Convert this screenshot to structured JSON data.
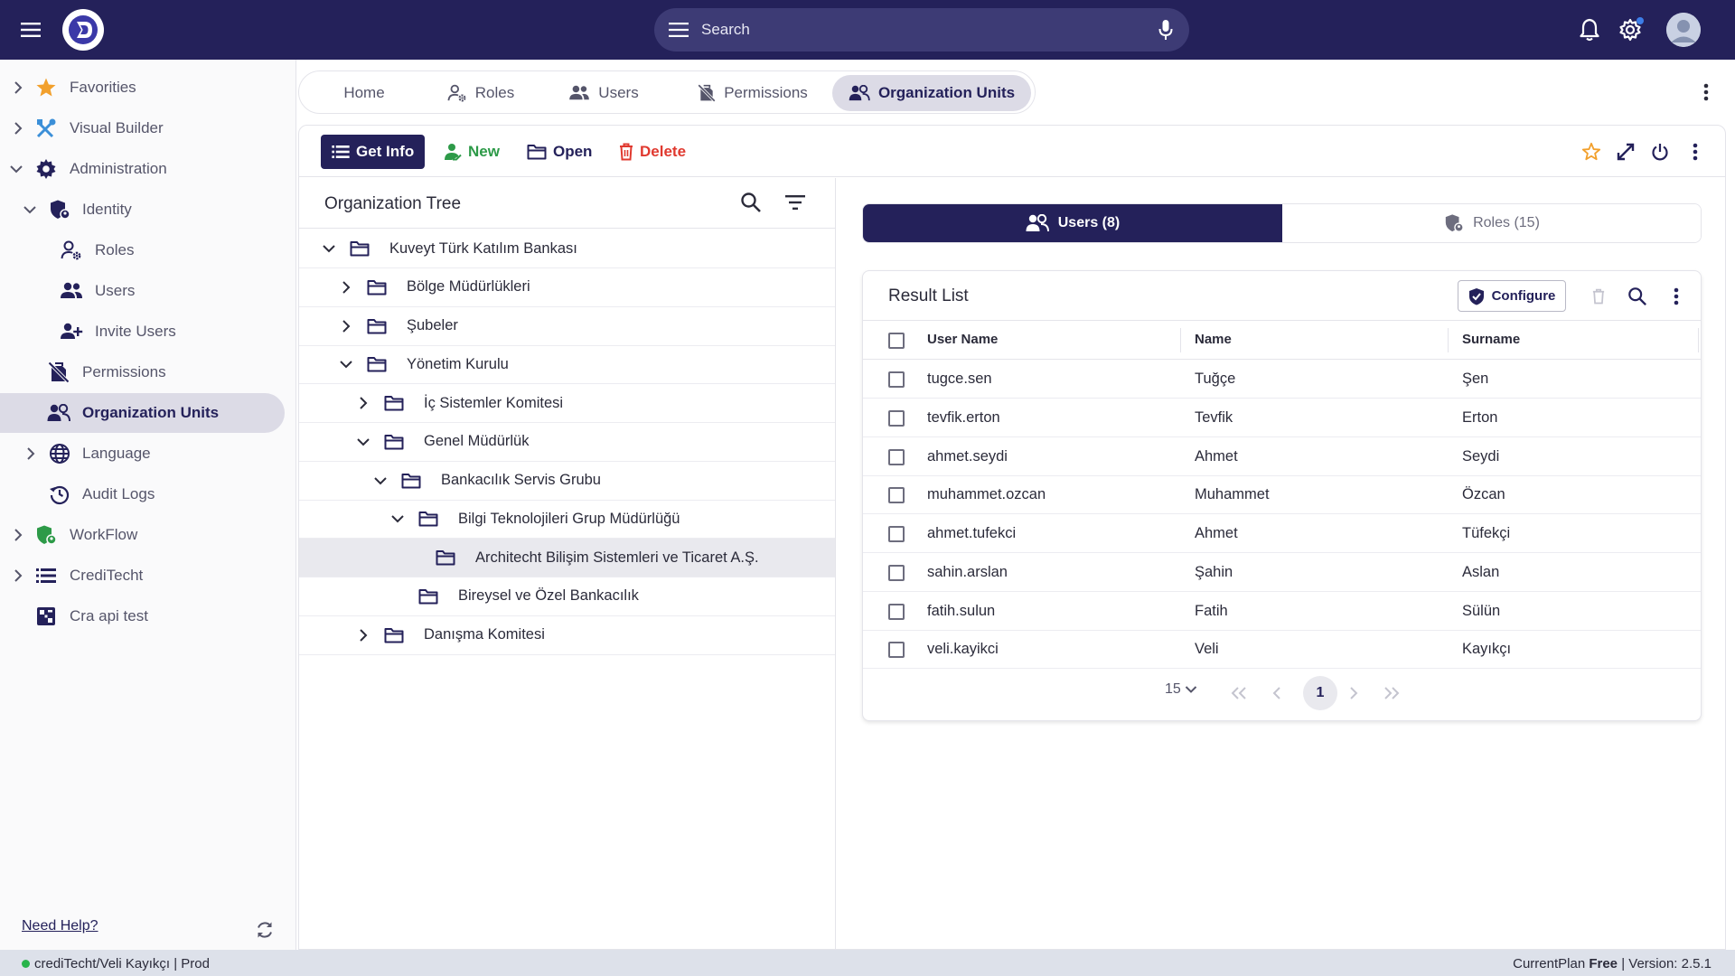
{
  "search": {
    "placeholder": "Search"
  },
  "sidebar": {
    "items": [
      {
        "label": "Favorities"
      },
      {
        "label": "Visual Builder"
      },
      {
        "label": "Administration"
      },
      {
        "label": "Identity"
      },
      {
        "label": "Roles"
      },
      {
        "label": "Users"
      },
      {
        "label": "Invite Users"
      },
      {
        "label": "Permissions"
      },
      {
        "label": "Organization Units"
      },
      {
        "label": "Language"
      },
      {
        "label": "Audit Logs"
      },
      {
        "label": "WorkFlow"
      },
      {
        "label": "CrediTecht"
      },
      {
        "label": "Cra api test"
      }
    ],
    "help": "Need Help?"
  },
  "tabs": [
    {
      "label": "Home"
    },
    {
      "label": "Roles"
    },
    {
      "label": "Users"
    },
    {
      "label": "Permissions"
    },
    {
      "label": "Organization Units",
      "active": true
    }
  ],
  "toolbar": {
    "get_info": "Get Info",
    "new": "New",
    "open": "Open",
    "delete": "Delete"
  },
  "tree": {
    "title": "Organization Tree",
    "nodes": [
      {
        "label": "Kuveyt Türk Katılım Bankası",
        "expanded": true
      },
      {
        "label": "Bölge Müdürlükleri",
        "expanded": false
      },
      {
        "label": "Şubeler",
        "expanded": false
      },
      {
        "label": "Yönetim Kurulu",
        "expanded": true
      },
      {
        "label": "İç Sistemler Komitesi",
        "expanded": false
      },
      {
        "label": "Genel Müdürlük",
        "expanded": true
      },
      {
        "label": "Bankacılık Servis Grubu",
        "expanded": true
      },
      {
        "label": "Bilgi Teknolojileri Grup Müdürlüğü",
        "expanded": true
      },
      {
        "label": "Architecht Bilişim Sistemleri ve Ticaret A.Ş.",
        "selected": true
      },
      {
        "label": "Bireysel ve Özel Bankacılık"
      },
      {
        "label": "Danışma Komitesi",
        "expanded": false
      }
    ]
  },
  "segments": {
    "users": "Users (8)",
    "roles": "Roles (15)"
  },
  "result": {
    "title": "Result List",
    "configure": "Configure",
    "columns": [
      "User Name",
      "Name",
      "Surname"
    ],
    "rows": [
      [
        "tugce.sen",
        "Tuğçe",
        "Şen"
      ],
      [
        "tevfik.erton",
        "Tevfik",
        "Erton"
      ],
      [
        "ahmet.seydi",
        "Ahmet",
        "Seydi"
      ],
      [
        "muhammet.ozcan",
        "Muhammet",
        "Özcan"
      ],
      [
        "ahmet.tufekci",
        "Ahmet",
        "Tüfekçi"
      ],
      [
        "sahin.arslan",
        "Şahin",
        "Aslan"
      ],
      [
        "fatih.sulun",
        "Fatih",
        "Sülün"
      ],
      [
        "veli.kayikci",
        "Veli",
        "Kayıkçı"
      ]
    ],
    "page_size": "15",
    "current_page": "1"
  },
  "status": {
    "left": "crediTecht/Veli Kayıkçı | Prod",
    "plan_label": "CurrentPlan",
    "plan_value": "Free",
    "version": "| Version: 2.5.1"
  },
  "colors": {
    "primary": "#24215a",
    "accent_green": "#2d9a48",
    "danger": "#e0392f",
    "star": "#f2a02c",
    "status_online": "#28b44b"
  }
}
